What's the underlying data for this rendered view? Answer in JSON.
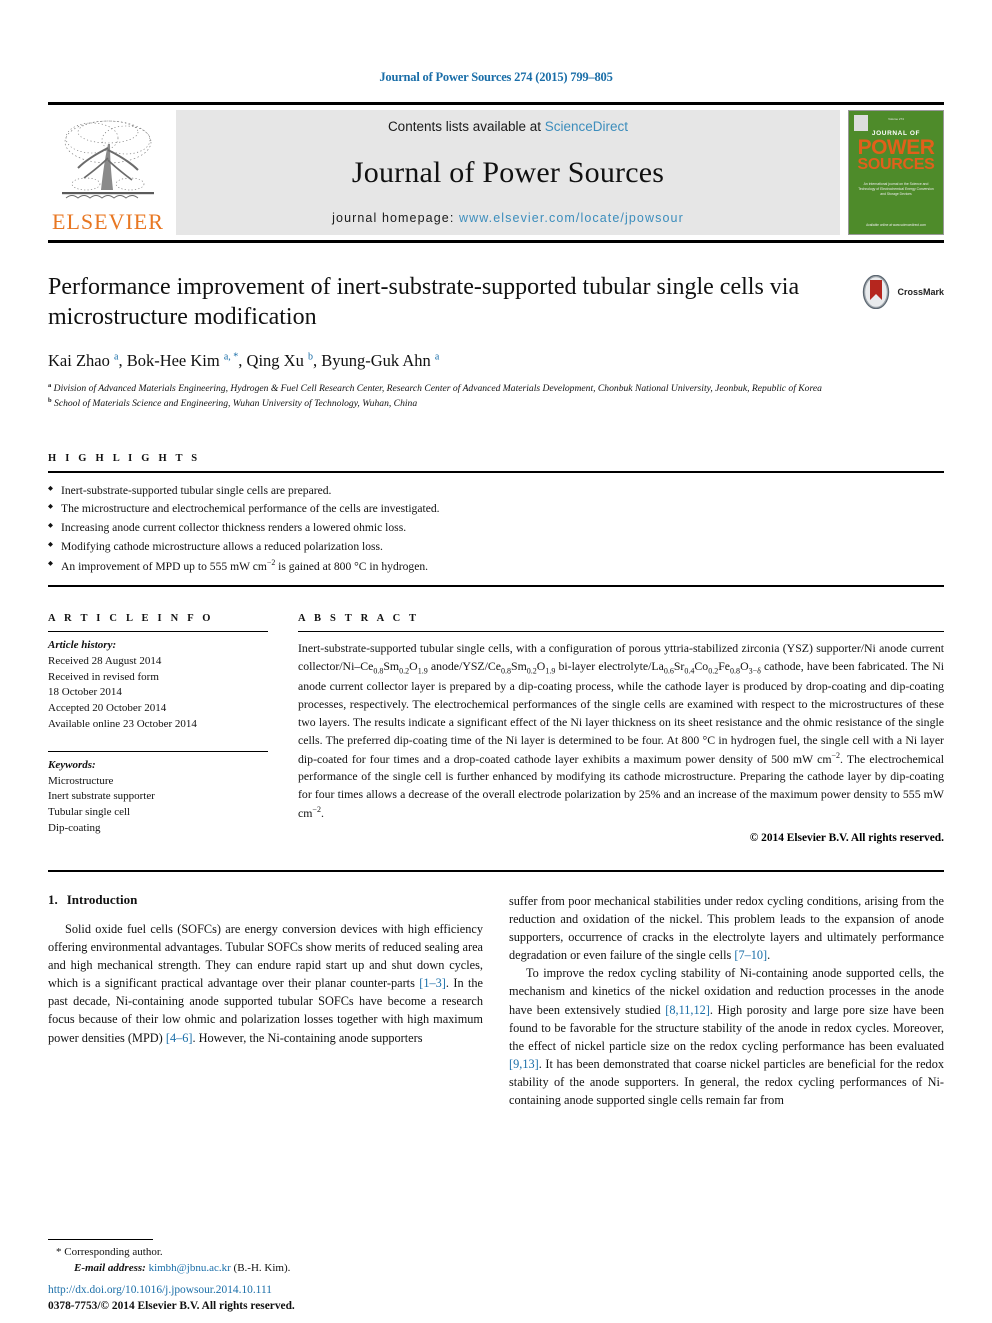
{
  "running_head": "Journal of Power Sources 274 (2015) 799–805",
  "masthead": {
    "contents_prefix": "Contents lists available at ",
    "sciencedirect": "ScienceDirect",
    "journal_name": "Journal of Power Sources",
    "homepage_prefix": "journal homepage: ",
    "homepage_url": "www.elsevier.com/locate/jpowsour",
    "publisher": "ELSEVIER",
    "cover": {
      "top_tiny": "Volume 274",
      "journal_of": "JOURNAL OF",
      "power": "POWER",
      "sources": "SOURCES",
      "description": "An international journal on the Science and Technology of Electrochemical Energy Conversion and Storage Devices",
      "footer": "Available online at www.sciencedirect.com"
    }
  },
  "crossmark": {
    "label": "CrossMark"
  },
  "article": {
    "title": "Performance improvement of inert-substrate-supported tubular single cells via microstructure modification",
    "authors_html": "Kai Zhao <sup>a</sup>, Bok-Hee Kim <sup>a, *</sup>, Qing Xu <sup>b</sup>, Byung-Guk Ahn <sup>a</sup>",
    "affiliation_a": "Division of Advanced Materials Engineering, Hydrogen & Fuel Cell Research Center, Research Center of Advanced Materials Development, Chonbuk National University, Jeonbuk, Republic of Korea",
    "affiliation_b": "School of Materials Science and Engineering, Wuhan University of Technology, Wuhan, China"
  },
  "highlights": {
    "label": "H I G H L I G H T S",
    "items_html": [
      "Inert-substrate-supported tubular single cells are prepared.",
      "The microstructure and electrochemical performance of the cells are investigated.",
      "Increasing anode current collector thickness renders a lowered ohmic loss.",
      "Modifying cathode microstructure allows a reduced polarization loss.",
      "An improvement of MPD up to 555 mW cm<sup>−2</sup> is gained at 800 °C in hydrogen."
    ]
  },
  "article_info": {
    "label": "A R T I C L E   I N F O",
    "history_label": "Article history:",
    "history": [
      "Received 28 August 2014",
      "Received in revised form",
      "18 October 2014",
      "Accepted 20 October 2014",
      "Available online 23 October 2014"
    ],
    "keywords_label": "Keywords:",
    "keywords": [
      "Microstructure",
      "Inert substrate supporter",
      "Tubular single cell",
      "Dip-coating"
    ]
  },
  "abstract": {
    "label": "A B S T R A C T",
    "text_html": "Inert-substrate-supported tubular single cells, with a configuration of porous yttria-stabilized zirconia (YSZ) supporter/Ni anode current collector/Ni–Ce<sub>0.8</sub>Sm<sub>0.2</sub>O<sub>1.9</sub> anode/YSZ/Ce<sub>0.8</sub>Sm<sub>0.2</sub>O<sub>1.9</sub> bi-layer electrolyte/La<sub>0.6</sub>Sr<sub>0.4</sub>Co<sub>0.2</sub>Fe<sub>0.8</sub>O<sub>3−δ</sub> cathode, have been fabricated. The Ni anode current collector layer is prepared by a dip-coating process, while the cathode layer is produced by drop-coating and dip-coating processes, respectively. The electrochemical performances of the single cells are examined with respect to the microstructures of these two layers. The results indicate a significant effect of the Ni layer thickness on its sheet resistance and the ohmic resistance of the single cells. The preferred dip-coating time of the Ni layer is determined to be four. At 800 °C in hydrogen fuel, the single cell with a Ni layer dip-coated for four times and a drop-coated cathode layer exhibits a maximum power density of 500 mW cm<sup>−2</sup>. The electrochemical performance of the single cell is further enhanced by modifying its cathode microstructure. Preparing the cathode layer by dip-coating for four times allows a decrease of the overall electrode polarization by 25% and an increase of the maximum power density to 555 mW cm<sup>−2</sup>.",
    "copyright": "© 2014 Elsevier B.V. All rights reserved."
  },
  "introduction": {
    "number": "1.",
    "heading": "Introduction",
    "left_paragraph_html": "Solid oxide fuel cells (SOFCs) are energy conversion devices with high efficiency offering environmental advantages. Tubular SOFCs show merits of reduced sealing area and high mechanical strength. They can endure rapid start up and shut down cycles, which is a significant practical advantage over their planar counter-parts <span class=\"ref\">[1–3]</span>. In the past decade, Ni-containing anode supported tubular SOFCs have become a research focus because of their low ohmic and polarization losses together with high maximum power densities (MPD) <span class=\"ref\">[4–6]</span>. However, the Ni-containing anode supporters",
    "right_paragraph_1_html": "suffer from poor mechanical stabilities under redox cycling conditions, arising from the reduction and oxidation of the nickel. This problem leads to the expansion of anode supporters, occurrence of cracks in the electrolyte layers and ultimately performance degradation or even failure of the single cells <span class=\"ref\">[7–10]</span>.",
    "right_paragraph_2_html": "To improve the redox cycling stability of Ni-containing anode supported cells, the mechanism and kinetics of the nickel oxidation and reduction processes in the anode have been extensively studied <span class=\"ref\">[8,11,12]</span>. High porosity and large pore size have been found to be favorable for the structure stability of the anode in redox cycles. Moreover, the effect of nickel particle size on the redox cycling performance has been evaluated <span class=\"ref\">[9,13]</span>. It has been demonstrated that coarse nickel particles are beneficial for the redox stability of the anode supporters. In general, the redox cycling performances of Ni-containing anode supported single cells remain far from"
  },
  "footnotes": {
    "corresponding_star": "*",
    "corresponding_label": "Corresponding author.",
    "email_label": "E-mail address:",
    "email": "kimbh@jbnu.ac.kr",
    "email_owner": "(B.-H. Kim).",
    "doi": "http://dx.doi.org/10.1016/j.jpowsour.2014.10.111",
    "issn_line": "0378-7753/© 2014 Elsevier B.V. All rights reserved."
  },
  "colors": {
    "link": "#1a6ea8",
    "sciencedirect": "#3c8dbc",
    "elsevier_orange": "#E87722",
    "cover_green": "#4e8b2a",
    "cover_orange": "#E2601A"
  }
}
